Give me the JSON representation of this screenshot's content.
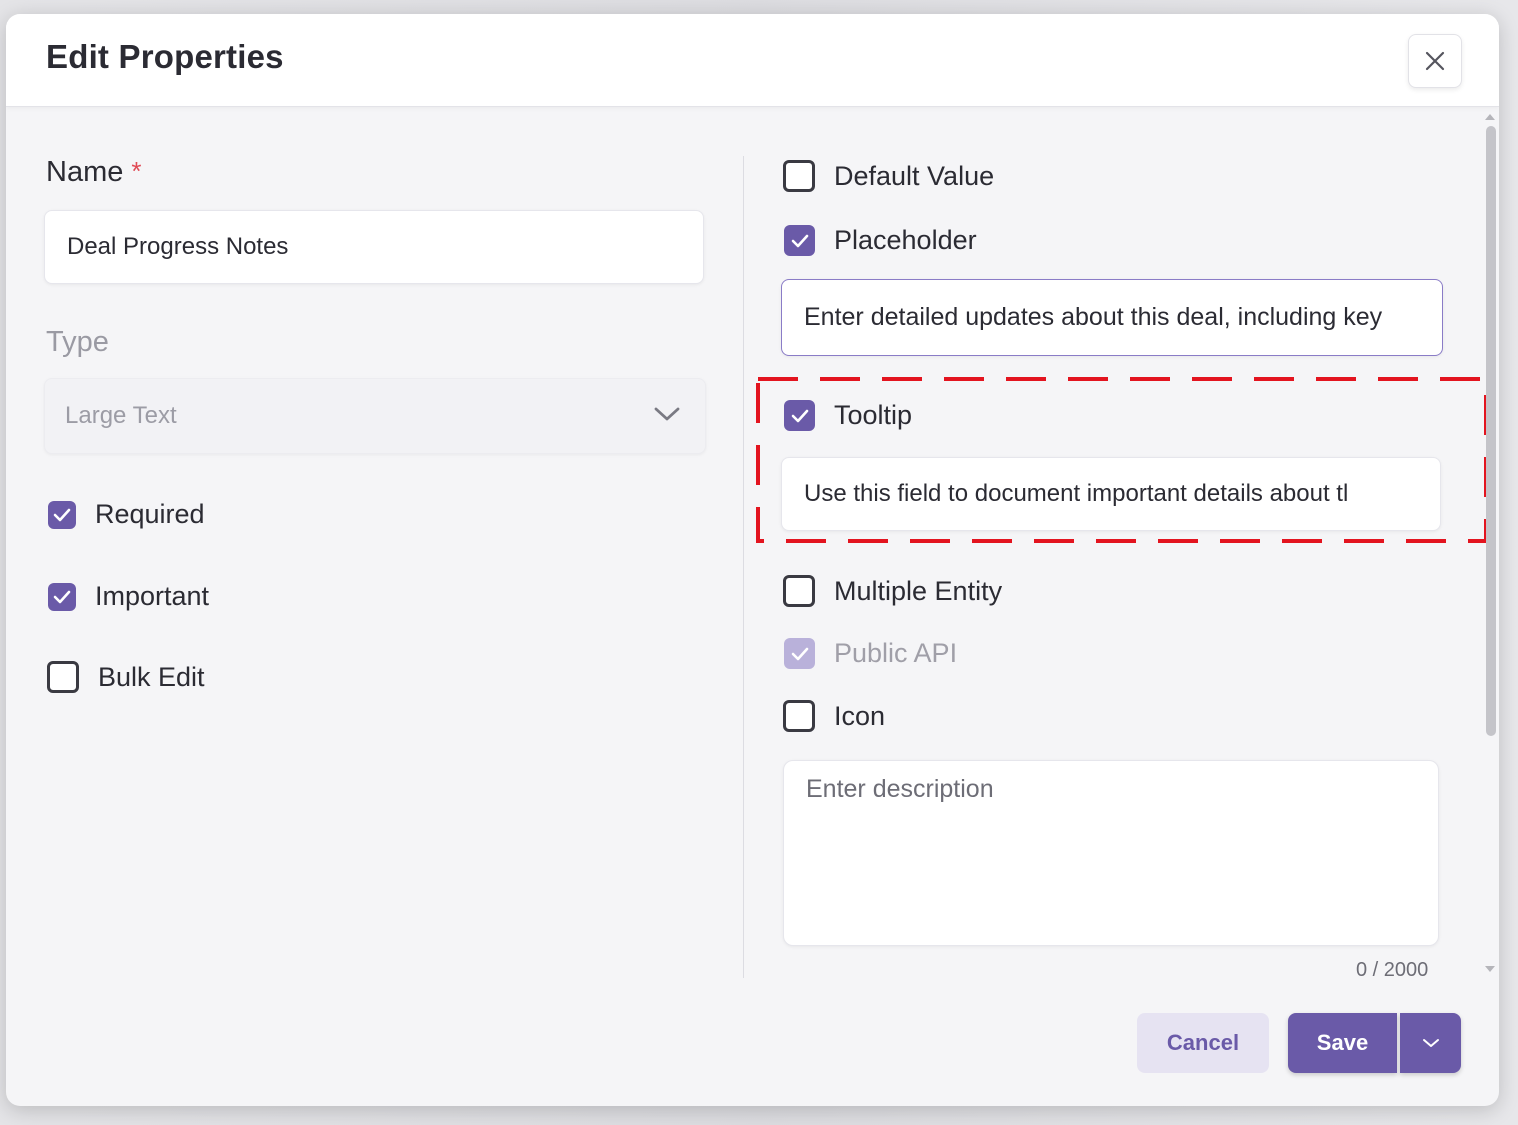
{
  "dialog": {
    "title": "Edit Properties",
    "close_icon": "close-icon"
  },
  "left": {
    "name_label": "Name",
    "required_star": "*",
    "name_value": "Deal Progress Notes",
    "type_label": "Type",
    "type_value": "Large Text",
    "checkboxes": [
      {
        "label": "Required",
        "checked": true
      },
      {
        "label": "Important",
        "checked": true
      },
      {
        "label": "Bulk Edit",
        "checked": false
      }
    ]
  },
  "right": {
    "default_value": {
      "label": "Default Value",
      "checked": false
    },
    "placeholder": {
      "label": "Placeholder",
      "checked": true,
      "value": "Enter detailed updates about this deal, including key"
    },
    "tooltip": {
      "label": "Tooltip",
      "checked": true,
      "value": "Use this field to document important details about tl"
    },
    "multiple_entity": {
      "label": "Multiple Entity",
      "checked": false
    },
    "public_api": {
      "label": "Public API",
      "checked": true,
      "disabled": true
    },
    "icon": {
      "label": "Icon",
      "checked": false
    },
    "description": {
      "placeholder": "Enter description",
      "counter": "0 / 2000"
    }
  },
  "footer": {
    "cancel_label": "Cancel",
    "save_label": "Save"
  },
  "colors": {
    "accent": "#6a5aa8",
    "highlight": "#e3141f",
    "required": "#e04a55"
  }
}
